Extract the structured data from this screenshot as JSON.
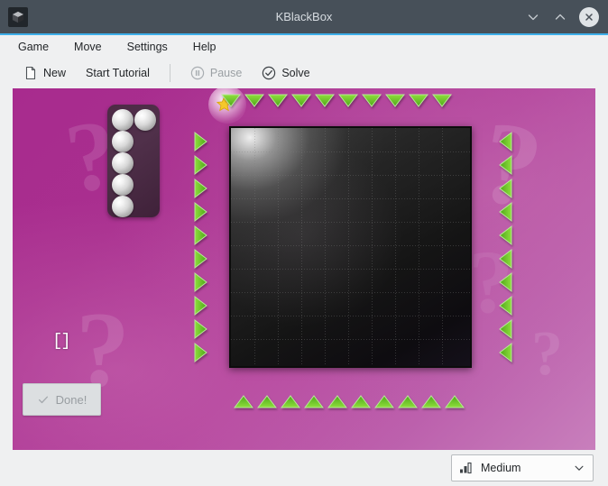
{
  "window": {
    "title": "KBlackBox",
    "app_icon": "cube-icon",
    "controls": {
      "minimize": "minimize-icon",
      "maximize": "maximize-icon",
      "close": "close-icon"
    }
  },
  "menubar": {
    "items": [
      {
        "label": "Game"
      },
      {
        "label": "Move"
      },
      {
        "label": "Settings"
      },
      {
        "label": "Help"
      }
    ]
  },
  "toolbar": {
    "items": [
      {
        "label": "New",
        "icon": "new-document-icon",
        "enabled": true
      },
      {
        "label": "Start Tutorial",
        "icon": null,
        "enabled": true
      },
      {
        "label": "Pause",
        "icon": "pause-icon",
        "enabled": false
      },
      {
        "label": "Solve",
        "icon": "check-circle-icon",
        "enabled": true
      }
    ]
  },
  "game": {
    "board": {
      "columns": 10,
      "rows": 10,
      "background_color": "#111111"
    },
    "laser_arrows": {
      "top_count": 10,
      "bottom_count": 10,
      "left_count": 10,
      "right_count": 10,
      "color": "#6fcf2a"
    },
    "ball_tray": {
      "balls_remaining": 6,
      "ball_color": "#e8e8e8",
      "tray_color": "#4b2b45",
      "positions": [
        {
          "col": 0,
          "row": 0
        },
        {
          "col": 1,
          "row": 0
        },
        {
          "col": 0,
          "row": 1
        },
        {
          "col": 0,
          "row": 2
        },
        {
          "col": 0,
          "row": 3
        },
        {
          "col": 0,
          "row": 4
        }
      ]
    },
    "marker": {
      "glyph": "[]",
      "label": "cursor-marker"
    },
    "star": {
      "label": "score-star",
      "color": "#f7d03c"
    },
    "done_button": {
      "label": "Done!",
      "icon": "check-icon",
      "enabled": false
    },
    "decor_question_marks": 5,
    "background_accent": "#a82b8e"
  },
  "statusbar": {
    "difficulty": {
      "selected": "Medium",
      "icon": "bars-icon",
      "chevron": "chevron-down-icon"
    }
  }
}
